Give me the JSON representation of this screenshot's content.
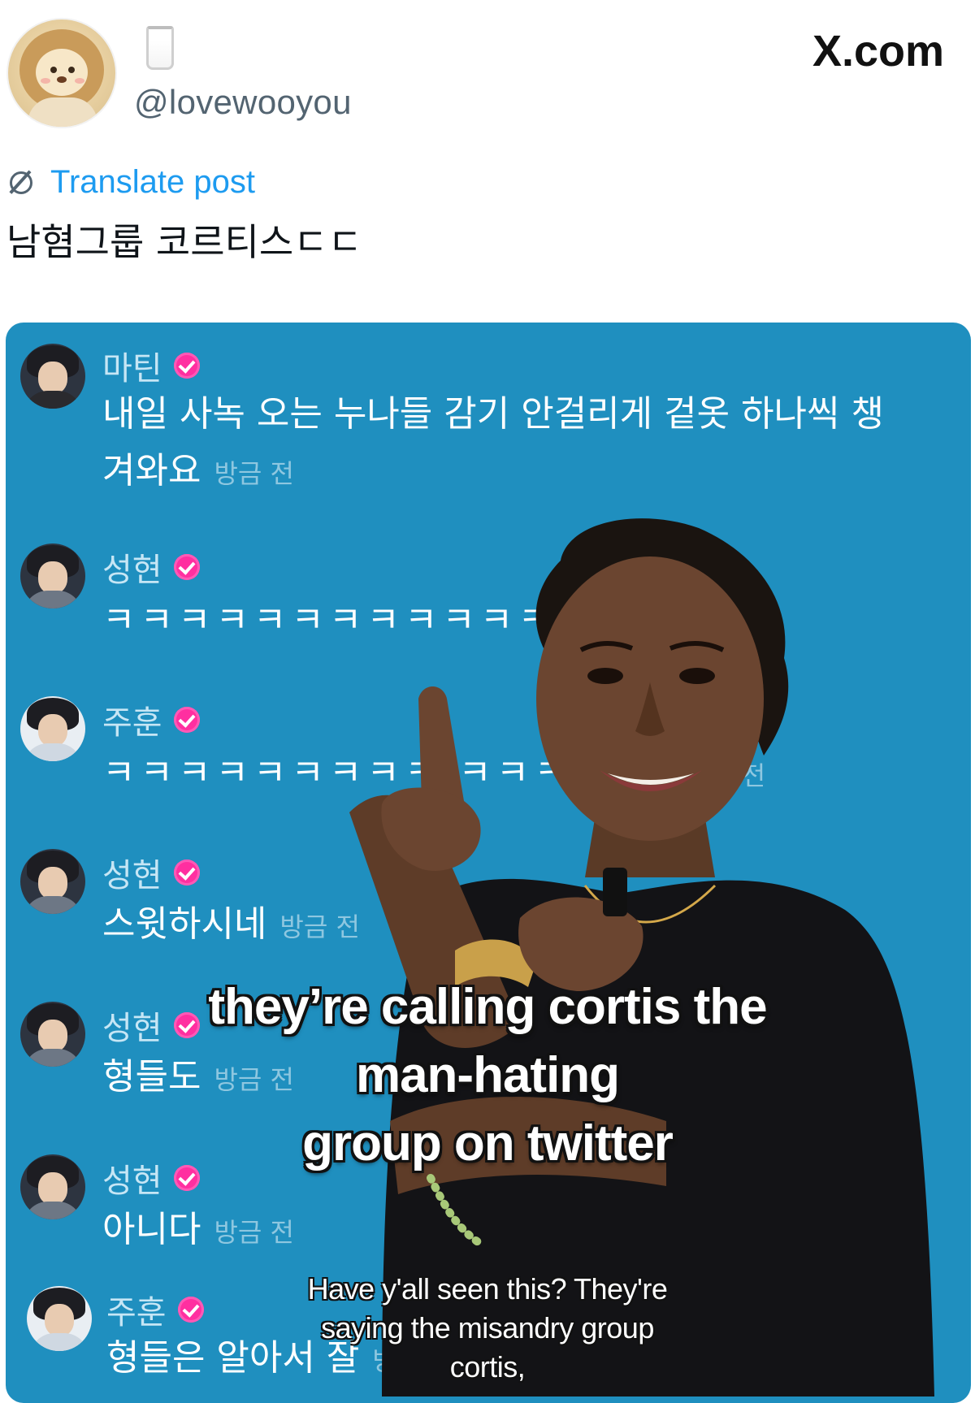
{
  "header": {
    "emoji": "🥛",
    "handle": "@lovewooyou",
    "site": "X.com"
  },
  "post": {
    "translate_label": "Translate post",
    "text": "남혐그룹 코르티스ㄷㄷ"
  },
  "comments": [
    {
      "name": "마틴",
      "text": "내일 사녹 오는 누나들 감기 안걸리게 겉옷 하나씩 챙",
      "text2": "겨와요",
      "time": "방금 전"
    },
    {
      "name": "성현",
      "text": "ㅋㅋㅋㅋㅋㅋㅋㅋㅋㅋㅋㅋㅋ",
      "time": ""
    },
    {
      "name": "주훈",
      "text": "ㅋㅋㅋㅋㅋㅋㅋㅋㅋ ㅋㅋㅋ",
      "time": "방금 전"
    },
    {
      "name": "성현",
      "text": "스윗하시네",
      "time": "방금 전"
    },
    {
      "name": "성현",
      "text": "형들도",
      "time": "방금 전"
    },
    {
      "name": "성현",
      "text": "아니다",
      "time": "방금 전"
    },
    {
      "name": "주훈",
      "text": "형들은 알아서 잘",
      "time": "방금"
    }
  ],
  "captions": {
    "main_line1": "they’re calling cortis the",
    "main_line2": "man-hating",
    "main_line3": "group on twitter",
    "sub_line1": "Have y'all seen this? They're",
    "sub_line2": "saying the misandry group",
    "sub_line3": "cortis,"
  },
  "colors": {
    "card_bg": "#1f8fbf",
    "link": "#1d9bf0",
    "verified_badge": "#ff2fa0"
  }
}
